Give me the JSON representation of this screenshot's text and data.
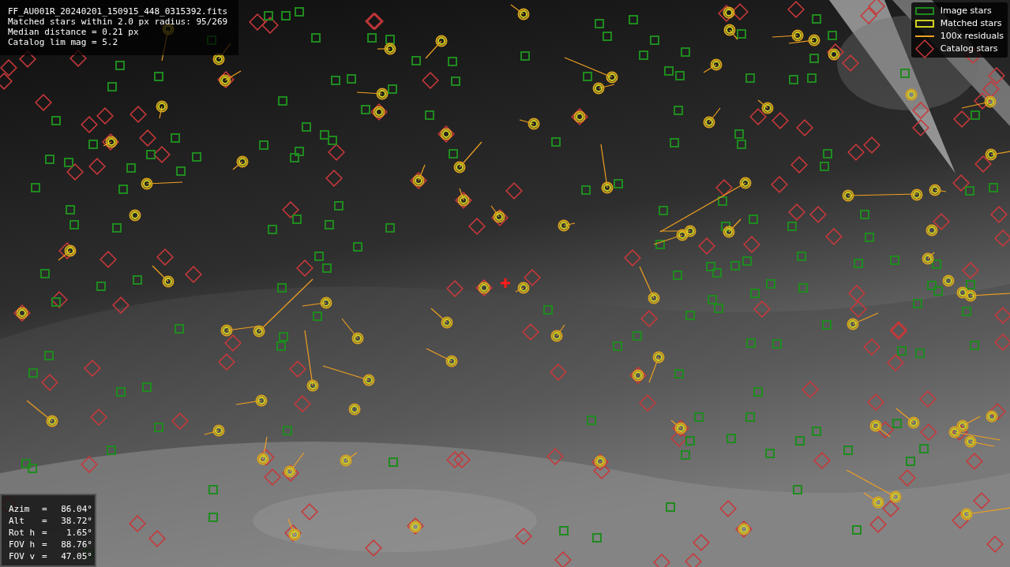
{
  "header": {
    "lines": [
      "FF_AU001R_20240201_150915_448_0315392.fits",
      "Matched stars within 2.0 px radius: 95/269",
      "Median distance = 0.21 px",
      "Catalog lim mag = 5.2"
    ]
  },
  "legend": [
    {
      "label": "Image stars"
    },
    {
      "kind": "matched",
      "label": "Matched stars"
    },
    {
      "kind": "residual",
      "label": "100x residuals"
    },
    {
      "kind": "catalog",
      "label": "Catalog stars"
    }
  ],
  "pointing": [
    {
      "label": "Azim",
      "sep": "=",
      "value": "86.04°"
    },
    {
      "label": "Alt",
      "sep": "=",
      "value": "38.72°"
    },
    {
      "label": "Rot h",
      "sep": "=",
      "value": "1.65°"
    },
    {
      "label": "FOV h",
      "sep": "=",
      "value": "88.76°"
    },
    {
      "label": "FOV v",
      "sep": "=",
      "value": "47.05°"
    }
  ]
}
